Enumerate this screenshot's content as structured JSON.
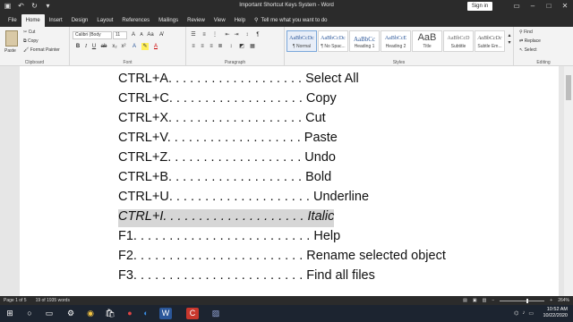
{
  "window": {
    "title": "Important Shortcut Keys System  -  Word",
    "signin": "Sign in"
  },
  "tabs": [
    "File",
    "Home",
    "Insert",
    "Design",
    "Layout",
    "References",
    "Mailings",
    "Review",
    "View",
    "Help"
  ],
  "tellme": "Tell me what you want to do",
  "ribbon": {
    "clipboard": {
      "paste": "Paste",
      "cut": "Cut",
      "copy": "Copy",
      "format_painter": "Format Painter",
      "label": "Clipboard"
    },
    "font": {
      "name": "Calibri (Body",
      "size": "11",
      "label": "Font"
    },
    "paragraph": {
      "label": "Paragraph"
    },
    "styles": {
      "label": "Styles",
      "items": [
        {
          "sample": "AaBbCcDc",
          "name": "¶ Normal"
        },
        {
          "sample": "AaBbCcDc",
          "name": "¶ No Spac..."
        },
        {
          "sample": "AaBbCc",
          "name": "Heading 1"
        },
        {
          "sample": "AaBbCcE",
          "name": "Heading 2"
        },
        {
          "sample": "AaB",
          "name": "Title"
        },
        {
          "sample": "AaBbCcD",
          "name": "Subtitle"
        },
        {
          "sample": "AaBbCcDc",
          "name": "Subtle Em..."
        }
      ]
    },
    "editing": {
      "find": "Find",
      "replace": "Replace",
      "select": "Select",
      "label": "Editing"
    }
  },
  "document": {
    "lines": [
      {
        "key": "CTRL+A",
        "dots": ". . . . . . . . . . . . . . . . . . .",
        "action": "Select All"
      },
      {
        "key": "CTRL+C",
        "dots": ". . . . . . . . . . . . . . . . . . .",
        "action": "Copy"
      },
      {
        "key": "CTRL+X",
        "dots": ". . . . . . . . . . . . . . . . . . .",
        "action": "Cut"
      },
      {
        "key": "CTRL+V",
        "dots": ". . . . . . . . . . . . . . . . . . .",
        "action": "Paste"
      },
      {
        "key": "CTRL+Z",
        "dots": ". . . . . . . . . . . . . . . . . . .",
        "action": "Undo"
      },
      {
        "key": "CTRL+B",
        "dots": ". . . . . . . . . . . . . . . . . . .",
        "action": "Bold"
      },
      {
        "key": "CTRL+U",
        "dots": ". . . . . . . . . . . . . . . . . . . .",
        "action": "Underline"
      },
      {
        "key": "CTRL+I",
        "dots": ". . . . . . . . . . . . . . . . . . . .",
        "action": "Italic"
      },
      {
        "key": "F1",
        "dots": ". . . . . . . . . . . . . . . . . . . . . . . . .",
        "action": "Help"
      },
      {
        "key": "F2",
        "dots": ". . . . . . . . . . . . . . . . . . . . . . . .",
        "action": "Rename selected object"
      },
      {
        "key": "F3",
        "dots": ". . . . . . . . . . . . . . . . . . . . . . . .",
        "action": "Find all files"
      }
    ]
  },
  "status": {
    "page": "Page 1 of 5",
    "words": "19 of 1935 words",
    "zoom": "264%"
  },
  "taskbar": {
    "time": "10:52 AM",
    "date": "10/22/2020"
  }
}
